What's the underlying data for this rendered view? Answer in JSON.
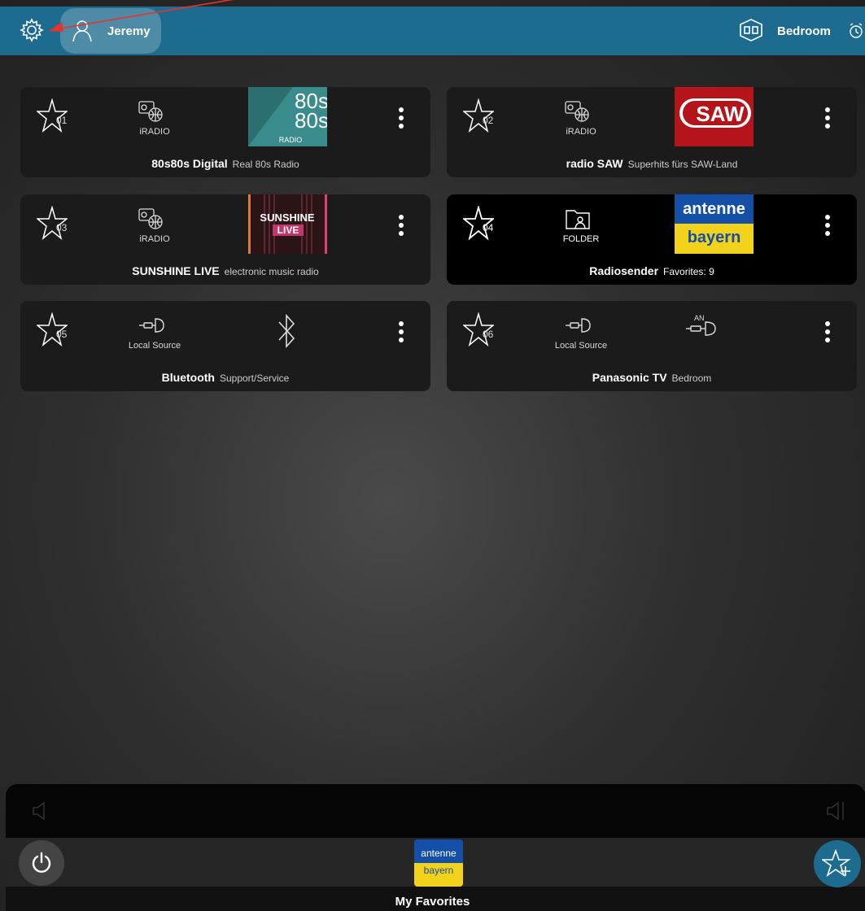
{
  "header": {
    "user_name": "Jeremy",
    "room_name": "Bedroom"
  },
  "presets": [
    {
      "slot": "01",
      "source": "iRADIO",
      "source_icon": "radio-globe-icon",
      "title": "80s80s Digital",
      "subtitle": "Real 80s Radio",
      "logo": {
        "lines": [
          "80s",
          "80s"
        ],
        "small": "RADIO",
        "bg": "#3a8b8c"
      }
    },
    {
      "slot": "02",
      "source": "iRADIO",
      "source_icon": "radio-globe-icon",
      "title": "radio SAW",
      "subtitle": "Superhits fürs SAW-Land",
      "logo": {
        "text": "SAW",
        "bg": "#b5141b"
      }
    },
    {
      "slot": "03",
      "source": "iRADIO",
      "source_icon": "radio-globe-icon",
      "title": "SUNSHINE LIVE",
      "subtitle": "electronic music radio",
      "logo": {
        "text": "SUNSHINE LIVE",
        "bg": "#2a1416",
        "accent": "#e0407a"
      }
    },
    {
      "slot": "04",
      "source": "FOLDER",
      "source_icon": "folder-user-icon",
      "title": "Radiosender",
      "subtitle": "Favorites: 9",
      "logo": {
        "top": "antenne",
        "bottom": "bayern",
        "top_bg": "#1450a8",
        "bottom_bg": "#f3d21b"
      }
    },
    {
      "slot": "05",
      "source": "Local Source",
      "source_icon": "aux-plug-icon",
      "title": "Bluetooth",
      "subtitle": "Support/Service",
      "logo": {
        "icon": "bluetooth-icon"
      }
    },
    {
      "slot": "06",
      "source": "Local Source",
      "source_icon": "aux-plug-icon",
      "title": "Panasonic TV",
      "subtitle": "Bedroom",
      "logo": {
        "icon": "analog-input-icon",
        "text": "AN"
      }
    }
  ],
  "now_playing": {
    "label": "My Favorites",
    "logo_top": "antenne",
    "logo_bottom": "bayern"
  },
  "colors": {
    "accent": "#1d6b8f",
    "card_bg": "#1b1b1b",
    "active_card_bg": "#000000",
    "annotation_arrow": "#e8332a"
  }
}
